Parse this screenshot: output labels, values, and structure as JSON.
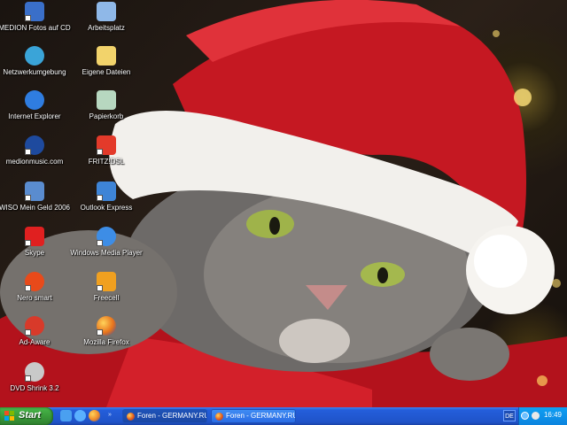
{
  "desktop": {
    "icons": [
      {
        "label": "MEDION Fotos auf CD",
        "icon": "photo-cd-icon",
        "color": "#3a6fc9"
      },
      {
        "label": "Arbeitsplatz",
        "icon": "computer-icon",
        "color": "#8fb8e8"
      },
      {
        "label": "Netzwerkumgebung",
        "icon": "network-icon",
        "color": "#3aa4d8"
      },
      {
        "label": "Eigene Dateien",
        "icon": "folder-icon",
        "color": "#f2d36b"
      },
      {
        "label": "Internet Explorer",
        "icon": "internet-explorer-icon",
        "color": "#2f7de0"
      },
      {
        "label": "Papierkorb",
        "icon": "recycle-bin-icon",
        "color": "#b7d7c0"
      },
      {
        "label": "medionmusic.com",
        "icon": "music-icon",
        "color": "#1e4a9e"
      },
      {
        "label": "FRITZ!DSL",
        "icon": "fritz-icon",
        "color": "#e33a2a"
      },
      {
        "label": "WISO Mein Geld 2006",
        "icon": "wiso-icon",
        "color": "#5a8ccf"
      },
      {
        "label": "Outlook Express",
        "icon": "outlook-icon",
        "color": "#3e84d6"
      },
      {
        "label": "Skype",
        "icon": "skype-s-icon",
        "color": "#e02020"
      },
      {
        "label": "Windows Media Player",
        "icon": "media-player-icon",
        "color": "#3d8de6"
      },
      {
        "label": "Nero smart",
        "icon": "nero-icon",
        "color": "#e84a1a"
      },
      {
        "label": "Freecell",
        "icon": "freecell-icon",
        "color": "#f0a020"
      },
      {
        "label": "Ad-Aware",
        "icon": "ad-aware-icon",
        "color": "#d83a2a"
      },
      {
        "label": "Mozilla Firefox",
        "icon": "firefox-icon",
        "color": "#e8731c"
      },
      {
        "label": "DVD Shrink 3.2",
        "icon": "dvd-shrink-icon",
        "color": "#c9c9c9"
      }
    ]
  },
  "taskbar": {
    "start_label": "Start",
    "quick_launch": [
      {
        "icon": "show-desktop-icon",
        "color": "#4aa0f0"
      },
      {
        "icon": "internet-explorer-icon",
        "color": "#5ab0ff"
      },
      {
        "icon": "firefox-icon",
        "color": "#f08a2a"
      }
    ],
    "tasks": [
      {
        "label": "Foren - GERMANY.RU...",
        "icon": "firefox-icon"
      },
      {
        "label": "Foren - GERMANY.RU...",
        "icon": "firefox-icon"
      }
    ],
    "language": "DE",
    "clock": "16:49"
  },
  "colors": {
    "taskbar_blue": "#245edb",
    "start_green": "#3a9b3a",
    "tray_blue": "#0b84df"
  }
}
